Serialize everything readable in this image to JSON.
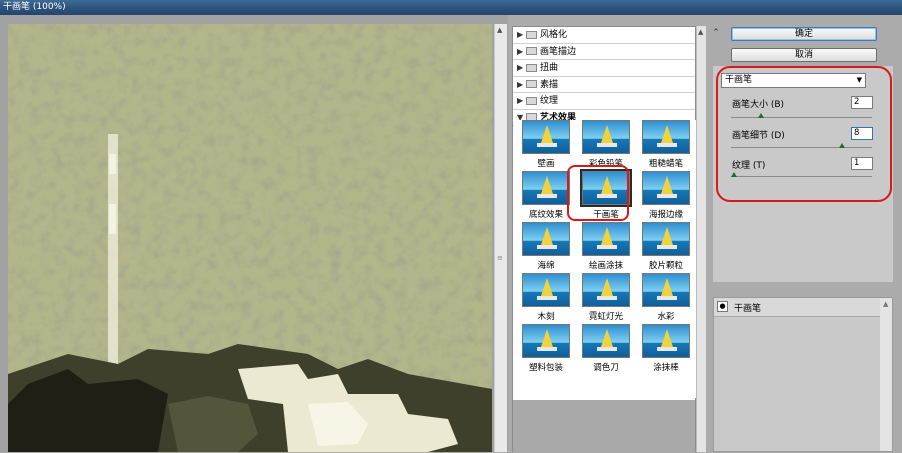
{
  "window": {
    "title": "干画笔 (100%)"
  },
  "categories": [
    {
      "label": "风格化",
      "open": false
    },
    {
      "label": "画笔描边",
      "open": false
    },
    {
      "label": "扭曲",
      "open": false
    },
    {
      "label": "素描",
      "open": false
    },
    {
      "label": "纹理",
      "open": false
    },
    {
      "label": "艺术效果",
      "open": true
    }
  ],
  "filters": [
    "壁画",
    "彩色铅笔",
    "粗糙蜡笔",
    "底纹效果",
    "干画笔",
    "海报边缘",
    "海绵",
    "绘画涂抹",
    "胶片颗粒",
    "木刻",
    "霓虹灯光",
    "水彩",
    "塑料包装",
    "调色刀",
    "涂抹棒"
  ],
  "selected_filter": "干画笔",
  "buttons": {
    "ok": "确定",
    "cancel": "取消"
  },
  "settings": {
    "filter_select": "干画笔",
    "brush_size": {
      "label": "画笔大小 (B)",
      "value": "2",
      "level": 0.2
    },
    "brush_detail": {
      "label": "画笔细节 (D)",
      "value": "8",
      "level": 0.8
    },
    "texture": {
      "label": "纹理 (T)",
      "value": "1",
      "level": 0.0
    }
  },
  "layers": [
    {
      "name": "干画笔"
    }
  ],
  "colors": {
    "highlight": "#d61a1a",
    "title_bar": "#2b507a"
  },
  "icons": [
    "collapse-icon",
    "eye-icon",
    "folder-icon",
    "expand-triangle-icon",
    "dropdown-arrow-icon"
  ]
}
